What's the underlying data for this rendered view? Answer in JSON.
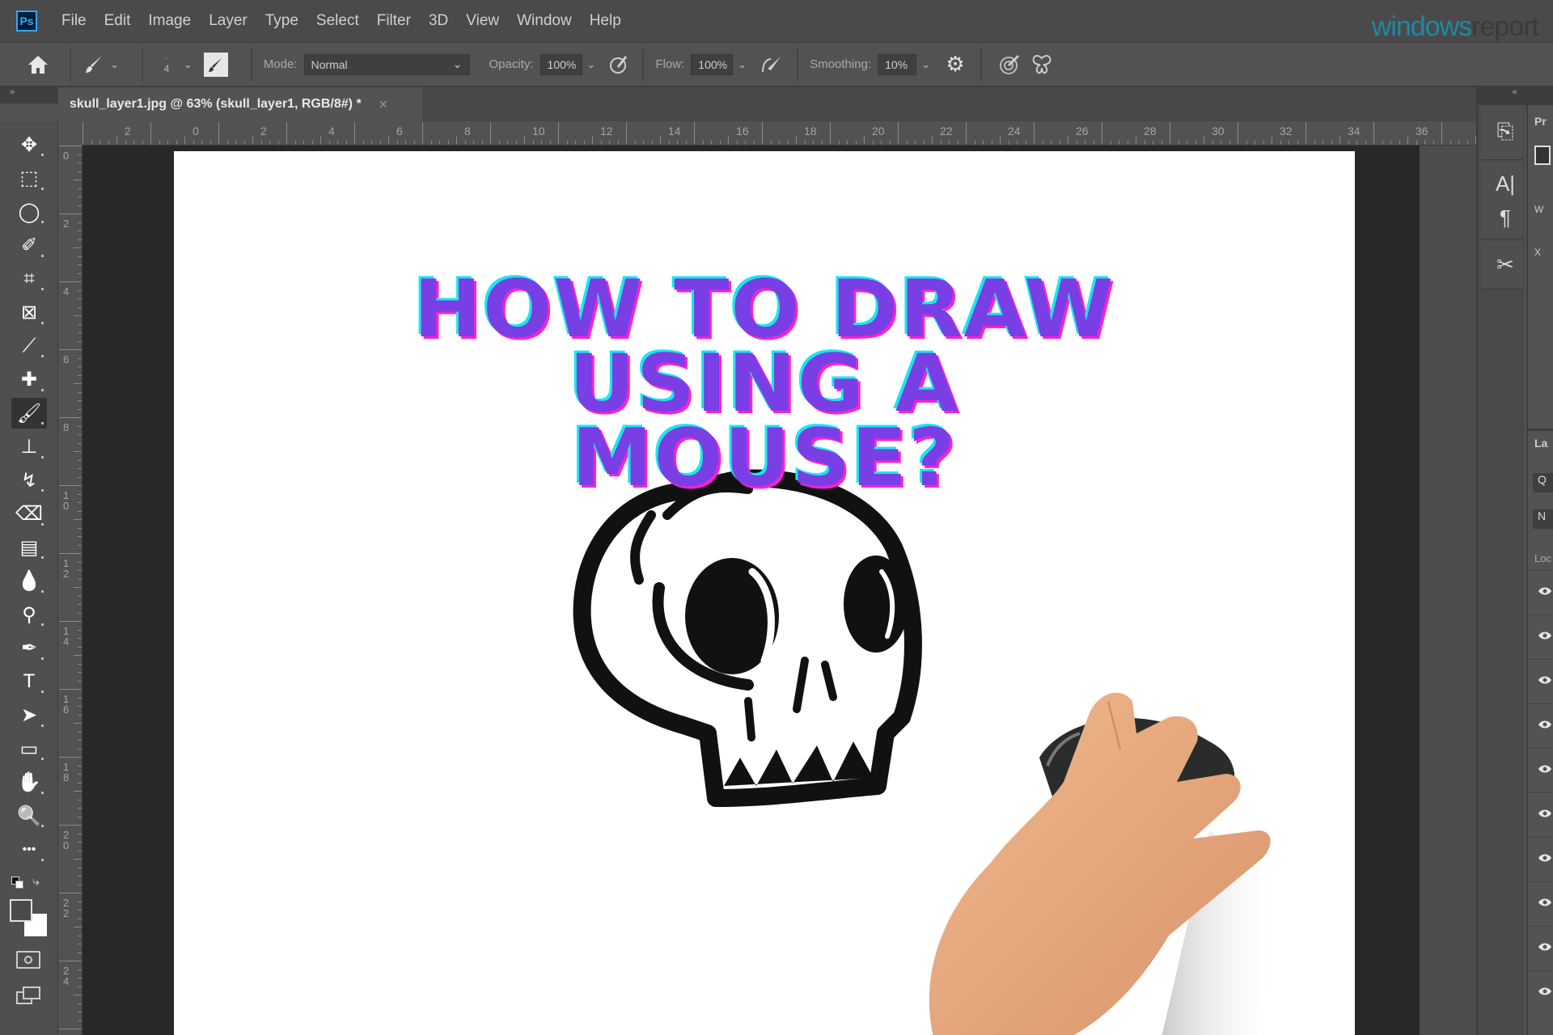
{
  "app": {
    "name": "Adobe Photoshop",
    "logo_text": "Ps"
  },
  "menu": [
    "File",
    "Edit",
    "Image",
    "Layer",
    "Type",
    "Select",
    "Filter",
    "3D",
    "View",
    "Window",
    "Help"
  ],
  "watermark": {
    "part1": "windows",
    "part2": "report"
  },
  "options_bar": {
    "brush_size": "4",
    "mode_label": "Mode:",
    "mode_value": "Normal",
    "opacity_label": "Opacity:",
    "opacity_value": "100%",
    "flow_label": "Flow:",
    "flow_value": "100%",
    "smoothing_label": "Smoothing:",
    "smoothing_value": "10%"
  },
  "document": {
    "tab_title": "skull_layer1.jpg @ 63% (skull_layer1, RGB/8#) *",
    "close_glyph": "×",
    "zoom": "63%"
  },
  "rulers": {
    "horizontal": [
      "2",
      "0",
      "2",
      "4",
      "6",
      "8",
      "10",
      "12",
      "14",
      "16",
      "18",
      "20",
      "22",
      "24",
      "26",
      "28",
      "30",
      "32",
      "34",
      "36"
    ],
    "vertical": [
      "0",
      "2",
      "4",
      "6",
      "8",
      "10",
      "12",
      "14",
      "16",
      "18",
      "20",
      "22",
      "24"
    ]
  },
  "tools": [
    {
      "name": "move-tool",
      "glyph": "✥"
    },
    {
      "name": "marquee-tool",
      "glyph": "⬚"
    },
    {
      "name": "lasso-tool",
      "glyph": "◯"
    },
    {
      "name": "quick-selection-tool",
      "glyph": "✐"
    },
    {
      "name": "crop-tool",
      "glyph": "⌗"
    },
    {
      "name": "frame-tool",
      "glyph": "⊠"
    },
    {
      "name": "eyedropper-tool",
      "glyph": "⟋"
    },
    {
      "name": "healing-brush-tool",
      "glyph": "✚"
    },
    {
      "name": "brush-tool",
      "glyph": "🖌"
    },
    {
      "name": "clone-stamp-tool",
      "glyph": "⊥"
    },
    {
      "name": "history-brush-tool",
      "glyph": "↯"
    },
    {
      "name": "eraser-tool",
      "glyph": "⌫"
    },
    {
      "name": "gradient-tool",
      "glyph": "▤"
    },
    {
      "name": "blur-tool",
      "glyph": "💧"
    },
    {
      "name": "dodge-tool",
      "glyph": "⚲"
    },
    {
      "name": "pen-tool",
      "glyph": "✒"
    },
    {
      "name": "type-tool",
      "glyph": "T"
    },
    {
      "name": "path-selection-tool",
      "glyph": "➤"
    },
    {
      "name": "rectangle-tool",
      "glyph": "▭"
    },
    {
      "name": "hand-tool",
      "glyph": "✋"
    },
    {
      "name": "zoom-tool",
      "glyph": "🔍"
    },
    {
      "name": "edit-toolbar",
      "glyph": "•••"
    }
  ],
  "active_tool": "brush-tool",
  "canvas_content": {
    "headline": [
      "HOW TO DRAW",
      "USING A",
      "MOUSE?"
    ],
    "colors": {
      "fill": "#7a3fe4",
      "cyan": "#19e7f0",
      "magenta": "#ff1fd6"
    }
  },
  "right_panel": {
    "collapse_glyph": "«",
    "properties_label": "Pr",
    "w_label": "W",
    "x_label": "X",
    "layers_label": "La",
    "search_placeholder": "Q",
    "blend_label": "N",
    "lock_label": "Loc",
    "layer_count_visible": 10
  }
}
